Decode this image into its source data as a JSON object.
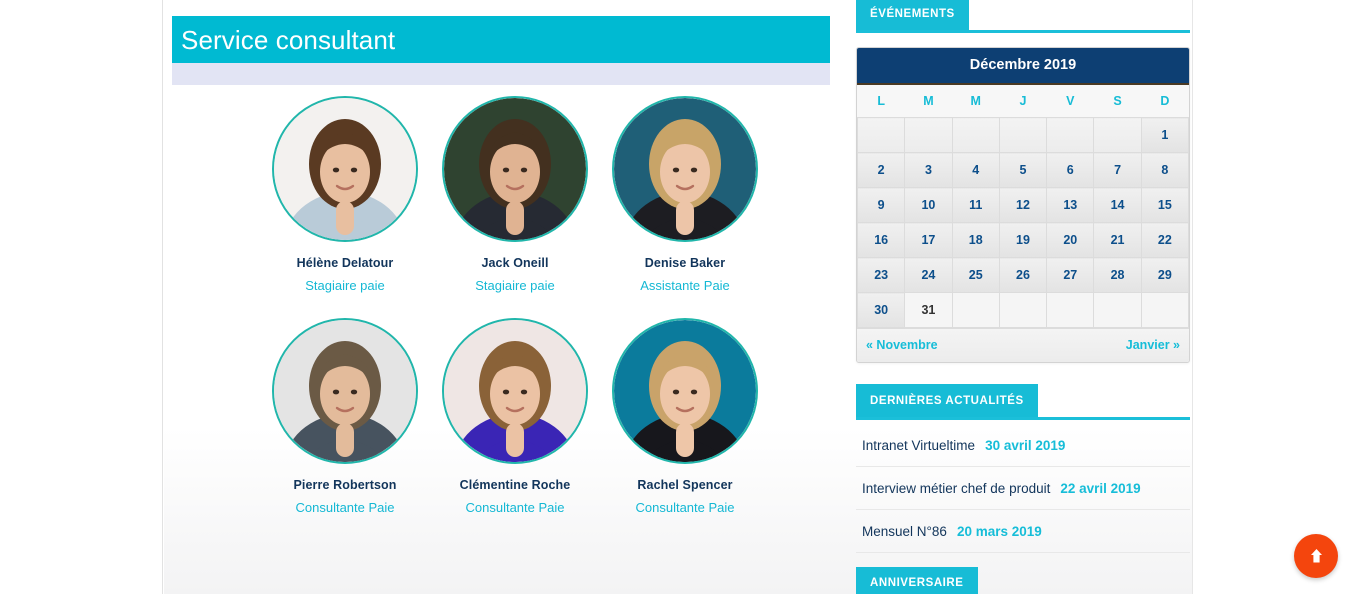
{
  "main": {
    "section_title": "Service consultant",
    "people": [
      {
        "name": "Hélène Delatour",
        "role": "Stagiaire paie",
        "photo": "portrait-woman-long-brown-hair-light-blue-shirt",
        "bg": "#f3f1ef",
        "hair": "#5a3a22",
        "skin": "#e8bfa0",
        "cloth": "#b9cbd8"
      },
      {
        "name": "Jack Oneill",
        "role": "Stagiaire paie",
        "photo": "portrait-man-dark-suit-outdoor-green-bokeh",
        "bg": "#2f4330",
        "hair": "#43301f",
        "skin": "#e0b392",
        "cloth": "#262a33"
      },
      {
        "name": "Denise Baker",
        "role": "Assistante Paie",
        "photo": "portrait-woman-blonde-wavy-hair-teal-backdrop",
        "bg": "#1f5f77",
        "hair": "#c8a468",
        "skin": "#edc5a8",
        "cloth": "#1d1d22"
      },
      {
        "name": "Pierre Robertson",
        "role": "Consultante Paie",
        "photo": "portrait-man-short-hair-grey-backdrop",
        "bg": "#e4e4e4",
        "hair": "#6b5a45",
        "skin": "#e3bb9b",
        "cloth": "#47535f"
      },
      {
        "name": "Clémentine Roche",
        "role": "Consultante Paie",
        "photo": "portrait-woman-blue-top-window-light",
        "bg": "#efe6e4",
        "hair": "#8a6238",
        "skin": "#ebc2a4",
        "cloth": "#3a25b5"
      },
      {
        "name": "Rachel Spencer",
        "role": "Consultante Paie",
        "photo": "portrait-woman-blonde-black-blazer-teal-backdrop",
        "bg": "#0b7b9c",
        "hair": "#c9a36a",
        "skin": "#eec6a8",
        "cloth": "#17171c"
      }
    ]
  },
  "sidebar": {
    "events": {
      "tab_label": "ÉVÉNEMENTS",
      "calendar": {
        "month_label": "Décembre 2019",
        "weekdays": [
          "L",
          "M",
          "M",
          "J",
          "V",
          "S",
          "D"
        ],
        "weeks": [
          [
            "",
            "",
            "",
            "",
            "",
            "",
            "1"
          ],
          [
            "2",
            "3",
            "4",
            "5",
            "6",
            "7",
            "8"
          ],
          [
            "9",
            "10",
            "11",
            "12",
            "13",
            "14",
            "15"
          ],
          [
            "16",
            "17",
            "18",
            "19",
            "20",
            "21",
            "22"
          ],
          [
            "23",
            "24",
            "25",
            "26",
            "27",
            "28",
            "29"
          ],
          [
            "30",
            "31",
            "",
            "",
            "",
            "",
            ""
          ]
        ],
        "prev_label": "« Novembre",
        "next_label": "Janvier »"
      }
    },
    "news": {
      "tab_label": "DERNIÈRES ACTUALITÉS",
      "items": [
        {
          "title": "Intranet Virtueltime",
          "date": "30 avril 2019"
        },
        {
          "title": "Interview métier chef de produit",
          "date": "22 avril 2019"
        },
        {
          "title": "Mensuel N°86",
          "date": "20 mars 2019"
        }
      ]
    },
    "birthday": {
      "tab_label": "ANNIVERSAIRE"
    }
  },
  "scroll_top": {
    "icon": "arrow-up-icon",
    "color": "#f4450d"
  },
  "colors": {
    "accent_cyan": "#17bcd6",
    "title_bar": "#00bad2",
    "lavender_strip": "#e2e4f4",
    "calendar_header": "#0d3f73",
    "name_navy": "#12355b",
    "avatar_ring": "#21b6ab"
  }
}
